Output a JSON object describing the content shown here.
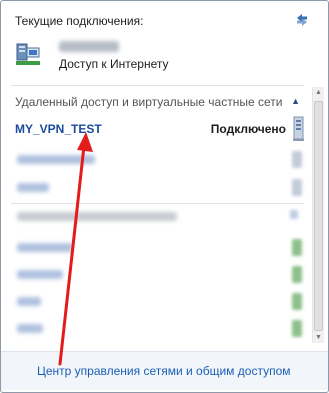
{
  "header": {
    "title": "Текущие подключения:",
    "refresh_icon": "refresh-icon"
  },
  "current_network": {
    "status": "Доступ к Интернету",
    "icon": "network-computer-icon"
  },
  "vpn_section": {
    "heading": "Удаленный доступ и виртуальные частные сети",
    "collapse_icon": "chevron-up-icon",
    "connection": {
      "name": "MY_VPN_TEST",
      "status": "Подключено",
      "icon": "vpn-server-icon"
    }
  },
  "footer": {
    "link": "Центр управления сетями и общим доступом"
  },
  "colors": {
    "link": "#1a5fb4",
    "vpn_name": "#1a4b9c",
    "annotation_arrow": "#e31b1b",
    "footer_bg": "#f2f5fa"
  }
}
